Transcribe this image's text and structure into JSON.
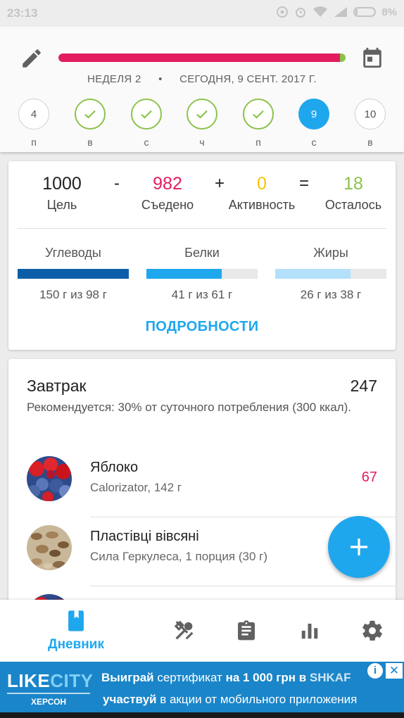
{
  "status_bar": {
    "time": "23:13",
    "battery": "8%"
  },
  "header": {
    "week": "НЕДЕЛЯ 2",
    "separator": "•",
    "today": "СЕГОДНЯ, 9 СЕНТ. 2017 Г.",
    "progress_fraction": 0.982,
    "days": [
      {
        "number": "4",
        "label": "п",
        "state": "past"
      },
      {
        "number": "",
        "label": "в",
        "state": "done"
      },
      {
        "number": "",
        "label": "с",
        "state": "done"
      },
      {
        "number": "",
        "label": "ч",
        "state": "done"
      },
      {
        "number": "",
        "label": "п",
        "state": "done"
      },
      {
        "number": "9",
        "label": "с",
        "state": "today"
      },
      {
        "number": "10",
        "label": "в",
        "state": "future"
      }
    ]
  },
  "summary": {
    "goal_value": "1000",
    "goal_label": "Цель",
    "minus": "-",
    "eaten_value": "982",
    "eaten_label": "Съедено",
    "plus": "+",
    "activity_value": "0",
    "activity_label": "Активность",
    "equals": "=",
    "left_value": "18",
    "left_label": "Осталось",
    "macros": [
      {
        "name": "Углеводы",
        "value": "150 г из 98 г",
        "fraction": 1.0,
        "color": "#0d5ea8"
      },
      {
        "name": "Белки",
        "value": "41 г из 61 г",
        "fraction": 0.68,
        "color": "#1fa7ee"
      },
      {
        "name": "Жиры",
        "value": "26 г из 38 г",
        "fraction": 0.68,
        "color": "#b3e0fb"
      }
    ],
    "details": "ПОДРОБНОСТИ"
  },
  "colors": {
    "accent": "#1fa7ee",
    "eaten": "#e21c5f",
    "activity": "#f5c400",
    "left": "#8bc34a"
  },
  "meal": {
    "title": "Завтрак",
    "total": "247",
    "recommendation": "Рекомендуется: 30% от суточного потребления (300 ккал).",
    "items": [
      {
        "name": "Яблоко",
        "detail": "Calorizator, 142 г",
        "kcal": "67"
      },
      {
        "name": "Пластівці вівсяні",
        "detail": "Сила Геркулеса, 1 порция (30 г)",
        "kcal": ""
      }
    ]
  },
  "bottom_nav": {
    "items": [
      {
        "icon": "diary-icon",
        "label": "Дневник"
      },
      {
        "icon": "meals-icon"
      },
      {
        "icon": "clipboard-icon"
      },
      {
        "icon": "chart-icon"
      },
      {
        "icon": "gear-icon"
      }
    ]
  },
  "ad": {
    "logo_like": "LIKE",
    "logo_city": "CITY",
    "logo_sub": "ХЕРСОН",
    "line1_a": "Выиграй",
    "line1_b": " сертификат ",
    "line1_c": "на 1 000 грн в",
    "line1_d": " SHKAF",
    "line2_a": "участвуй",
    "line2_b": " в акции от мобильного приложения",
    "info": "i",
    "close": "✕"
  }
}
